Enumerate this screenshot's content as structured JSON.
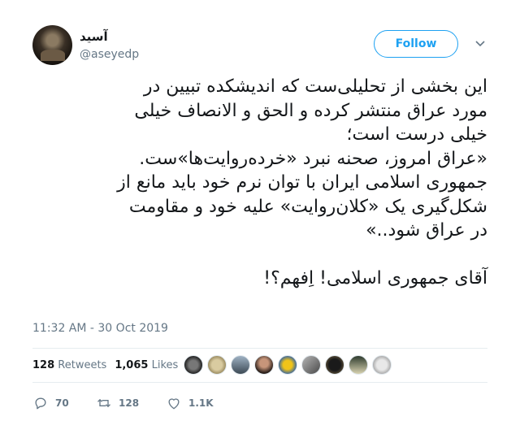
{
  "user": {
    "display_name": "آسید",
    "handle": "@aseyedp"
  },
  "follow_label": "Follow",
  "tweet_text": "این بخشی از تحلیلی‌ست که اندیشکده تبیین در\nمورد عراق منتشر کرده و الحق و الانصاف خیلی\nخیلی درست است؛\n«عراق امروز، صحنه نبرد «خرده‌روایت‌ها»ست.\nجمهوری اسلامی ایران با توان نرم خود باید مانع از\nشکل‌گیری یک «کلان‌روایت» علیه خود و مقاومت\nدر عراق شود..»\n\nآقای جمهوری اسلامی! اِفهم؟!",
  "timestamp": "11:32 AM - 30 Oct 2019",
  "stats": {
    "retweets_count": "128",
    "retweets_label": "Retweets",
    "likes_count": "1,065",
    "likes_label": "Likes"
  },
  "actions": {
    "replies": "70",
    "retweets": "128",
    "likes": "1.1K"
  },
  "colors": {
    "accent": "#1da1f2",
    "muted": "#657786",
    "text": "#14171a"
  },
  "icons": [
    "reply-icon",
    "retweet-icon",
    "heart-icon",
    "chevron-down-icon"
  ]
}
